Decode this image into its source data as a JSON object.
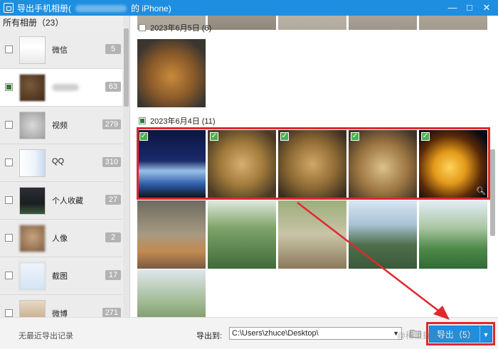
{
  "window": {
    "title_prefix": "导出手机相册(",
    "title_suffix": "的 iPhone)",
    "min_glyph": "—",
    "max_glyph": "□",
    "close_glyph": "✕"
  },
  "sidebar": {
    "header": "所有相册（23）",
    "albums": [
      {
        "name": "微信",
        "count": "5"
      },
      {
        "name": "",
        "count": "63"
      },
      {
        "name": "视频",
        "count": "279"
      },
      {
        "name": "QQ",
        "count": "310"
      },
      {
        "name": "个人收藏",
        "count": "27"
      },
      {
        "name": "人像",
        "count": "2"
      },
      {
        "name": "截图",
        "count": "17"
      },
      {
        "name": "微博",
        "count": "271"
      }
    ]
  },
  "main": {
    "groups": [
      {
        "date": "2023年6月5日 (6)"
      },
      {
        "date": "2023年6月4日 (11)"
      }
    ]
  },
  "bottom": {
    "no_record": "无最近导出记录",
    "export_to_label": "导出到:",
    "path_value": "C:\\Users\\zhuce\\Desktop\\",
    "export_label": "导出（5）",
    "dropdown_glyph": "▼"
  },
  "overlay": {
    "watermark": "@稀土掘金技术社区"
  },
  "colors": {
    "accent": "#1e8fe0",
    "highlight": "#e0282e",
    "check": "#4caf50"
  }
}
